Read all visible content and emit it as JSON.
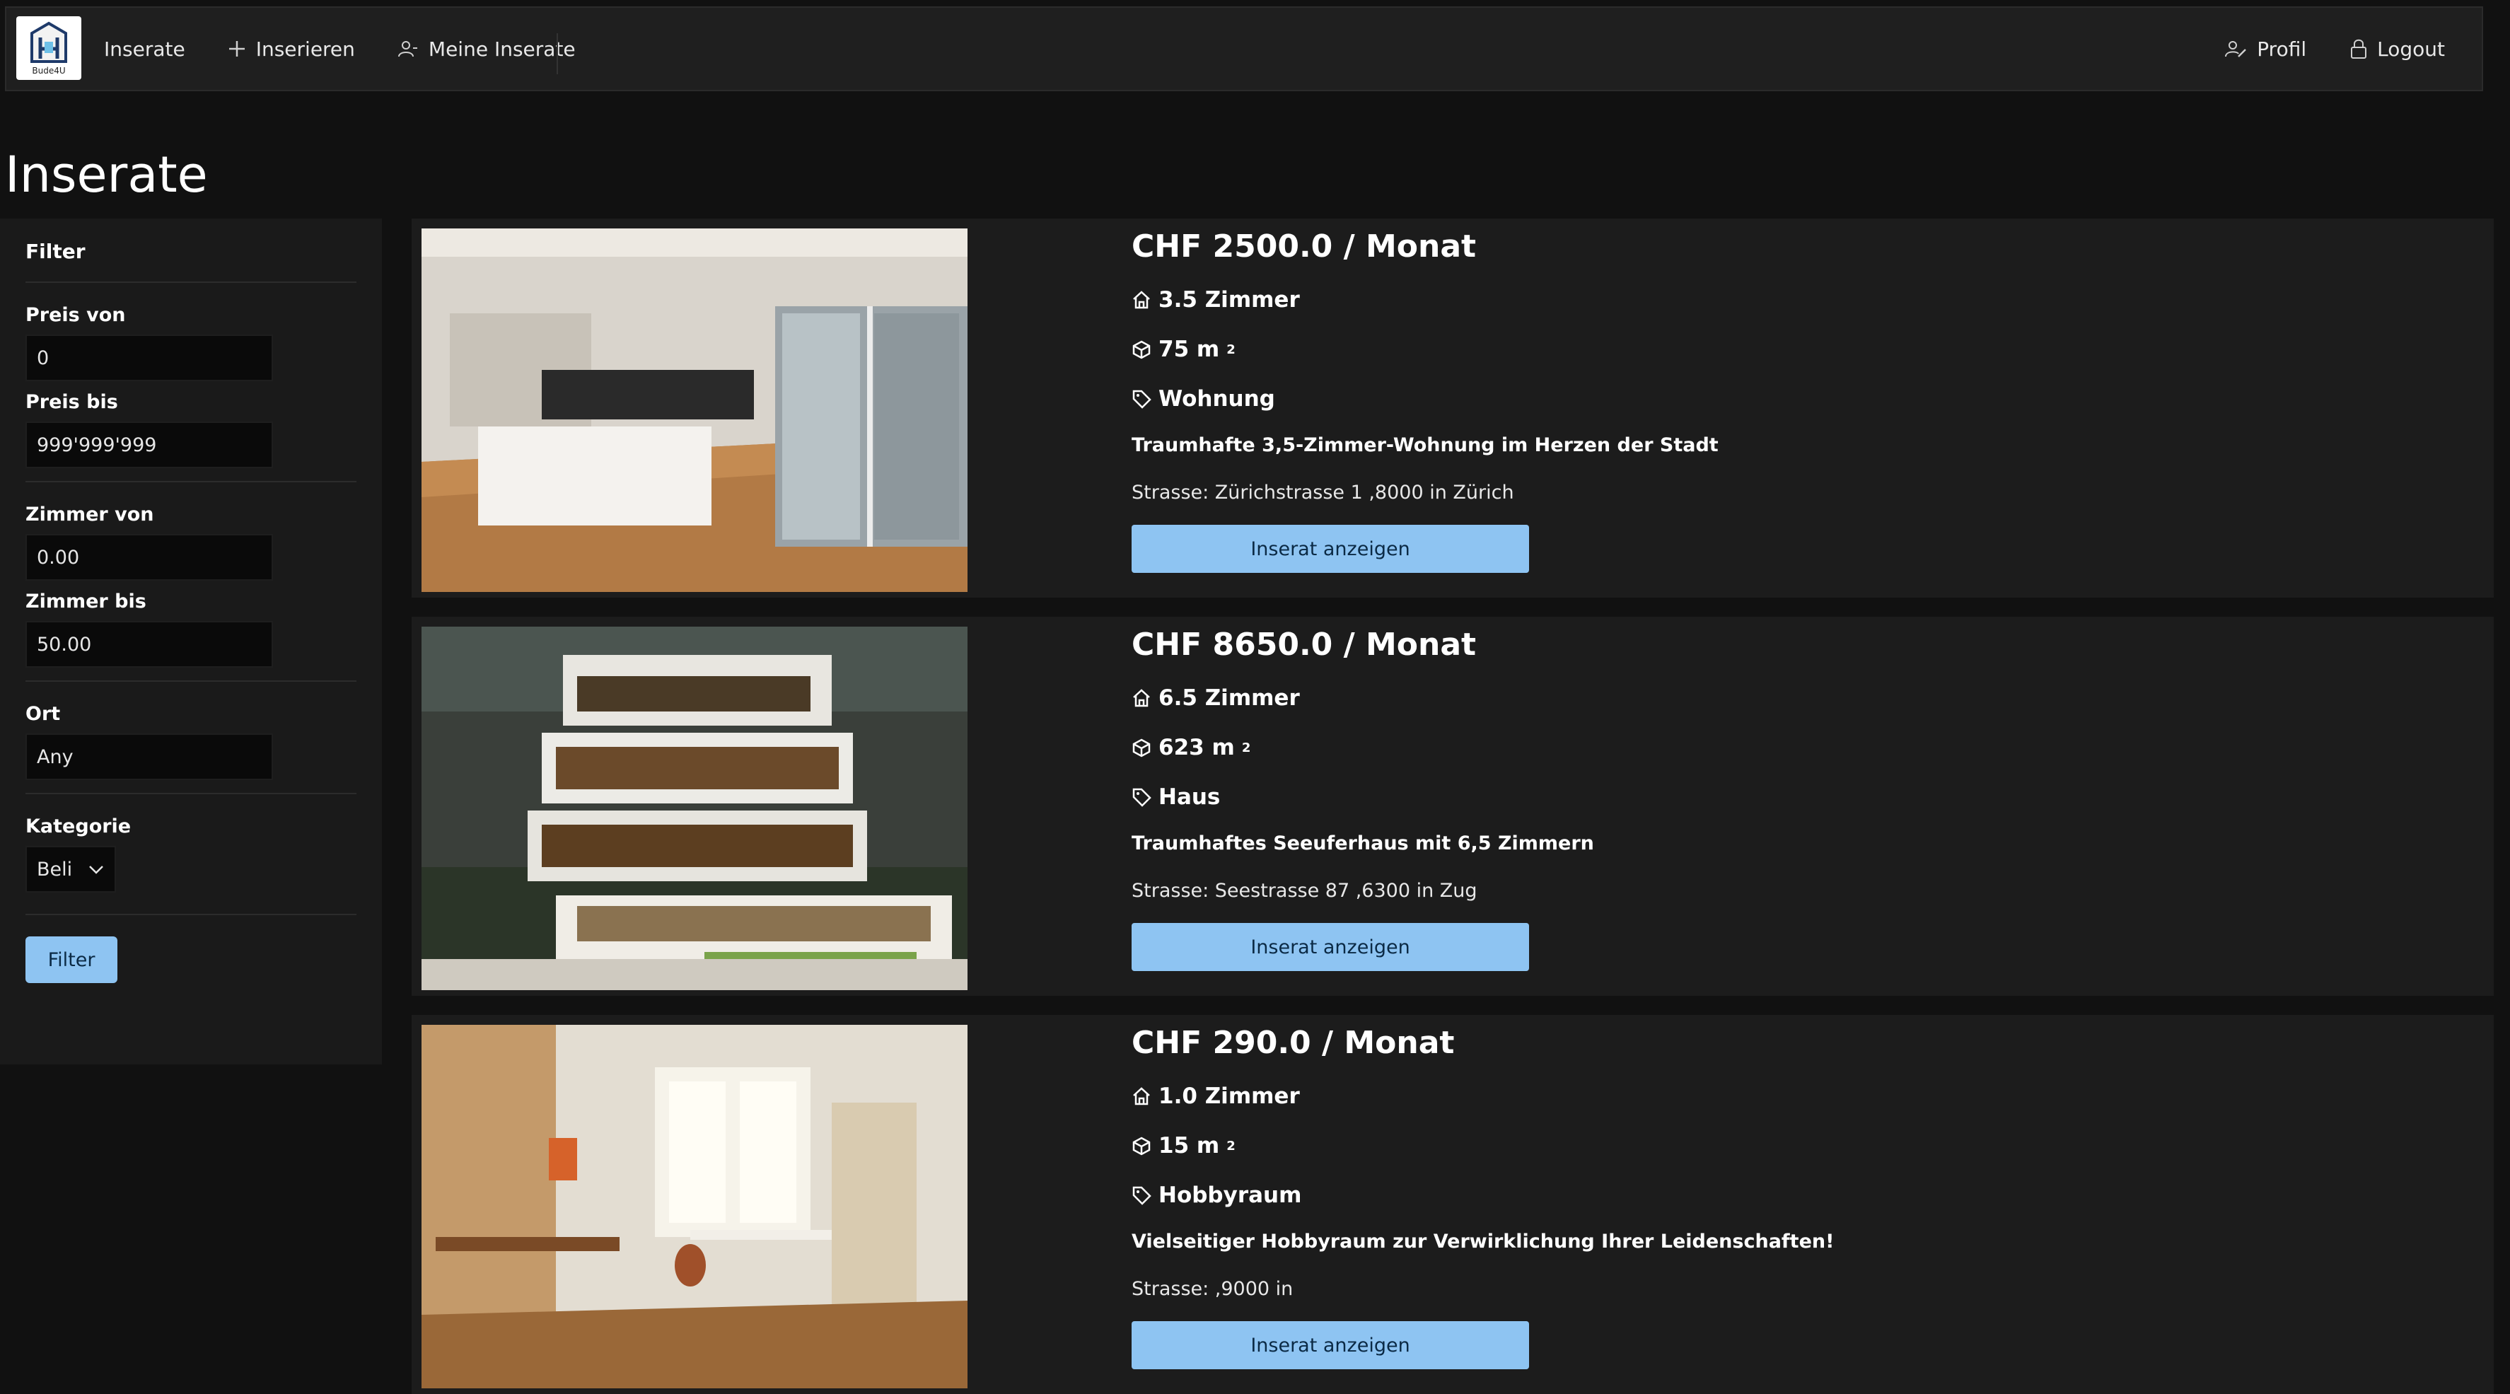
{
  "brand": {
    "logo_text": "Bude4U"
  },
  "nav": {
    "left": [
      {
        "label": "Inserate",
        "icon": "none"
      },
      {
        "label": "Inserieren",
        "icon": "plus-icon"
      },
      {
        "label": "Meine Inserate",
        "icon": "user-group-icon"
      }
    ],
    "right": [
      {
        "label": "Profil",
        "icon": "user-edit-icon"
      },
      {
        "label": "Logout",
        "icon": "lock-icon"
      }
    ]
  },
  "page": {
    "title": "Inserate"
  },
  "filter": {
    "title": "Filter",
    "price_from_label": "Preis von",
    "price_from_value": "0",
    "price_to_label": "Preis bis",
    "price_to_value": "999'999'999",
    "rooms_from_label": "Zimmer von",
    "rooms_from_value": "0.00",
    "rooms_to_label": "Zimmer bis",
    "rooms_to_value": "50.00",
    "place_label": "Ort",
    "place_value": "Any",
    "category_label": "Kategorie",
    "category_value": "Beli",
    "button_label": "Filter"
  },
  "listings": [
    {
      "price": "CHF 2500.0 / Monat",
      "rooms": "3.5 Zimmer",
      "area": "75 m",
      "area_unit_sup": "2",
      "category": "Wohnung",
      "description": "Traumhafte 3,5-Zimmer-Wohnung im Herzen der Stadt",
      "address": "Strasse: Zürichstrasse 1 ,8000 in Zürich",
      "button_label": "Inserat anzeigen",
      "image": "modern-apartment-kitchen-photo"
    },
    {
      "price": "CHF 8650.0 / Monat",
      "rooms": "6.5 Zimmer",
      "area": "623 m",
      "area_unit_sup": "2",
      "category": "Haus",
      "description": "Traumhaftes Seeuferhaus mit 6,5 Zimmern",
      "address": "Strasse: Seestrasse 87 ,6300 in Zug",
      "button_label": "Inserat anzeigen",
      "image": "modern-villa-night-photo"
    },
    {
      "price": "CHF 290.0 / Monat",
      "rooms": "1.0 Zimmer",
      "area": "15 m",
      "area_unit_sup": "2",
      "category": "Hobbyraum",
      "description": "Vielseitiger Hobbyraum zur Verwirklichung Ihrer Leidenschaften!",
      "address": "Strasse: ,9000 in",
      "button_label": "Inserat anzeigen",
      "image": "hobby-workshop-room-photo"
    }
  ],
  "colors": {
    "accent": "#8ec4f2",
    "background": "#111111",
    "panel": "#1c1c1c"
  }
}
